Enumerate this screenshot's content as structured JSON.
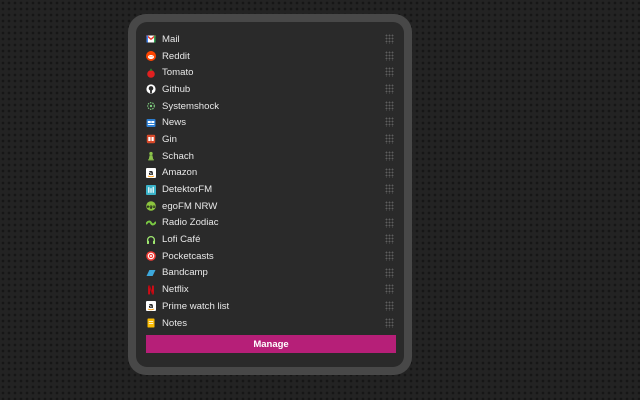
{
  "bookmarks": [
    {
      "label": "Mail",
      "icon": "gmail-icon"
    },
    {
      "label": "Reddit",
      "icon": "reddit-icon"
    },
    {
      "label": "Tomato",
      "icon": "tomato-icon"
    },
    {
      "label": "Github",
      "icon": "github-icon"
    },
    {
      "label": "Systemshock",
      "icon": "systemshock-icon"
    },
    {
      "label": "News",
      "icon": "news-icon"
    },
    {
      "label": "Gin",
      "icon": "gin-icon"
    },
    {
      "label": "Schach",
      "icon": "chess-pawn-icon"
    },
    {
      "label": "Amazon",
      "icon": "amazon-icon"
    },
    {
      "label": "DetektorFM",
      "icon": "detektorfm-icon"
    },
    {
      "label": "egoFM NRW",
      "icon": "egofm-icon"
    },
    {
      "label": "Radio Zodiac",
      "icon": "radio-zodiac-icon"
    },
    {
      "label": "Lofi Café",
      "icon": "headphones-icon"
    },
    {
      "label": "Pocketcasts",
      "icon": "pocketcasts-icon"
    },
    {
      "label": "Bandcamp",
      "icon": "bandcamp-icon"
    },
    {
      "label": "Netflix",
      "icon": "netflix-icon"
    },
    {
      "label": "Prime watch list",
      "icon": "amazon-icon"
    },
    {
      "label": "Notes",
      "icon": "notes-icon"
    }
  ],
  "manage_label": "Manage",
  "colors": {
    "accent": "#b61f78",
    "panel": "#2a2a2a",
    "frame": "#484848",
    "text": "#e8e8e8"
  }
}
